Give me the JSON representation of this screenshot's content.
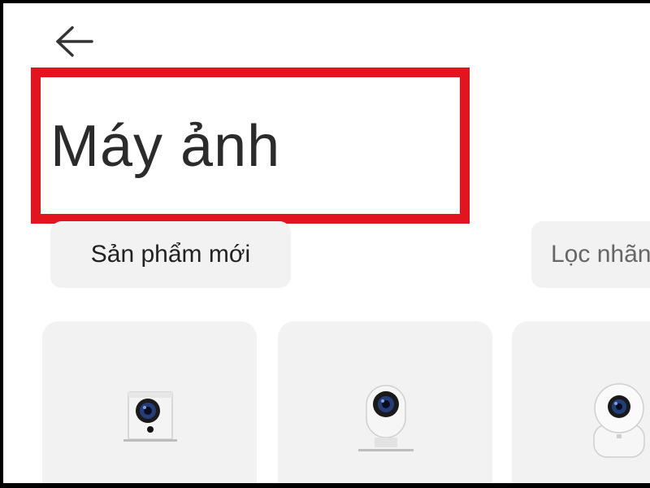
{
  "header": {
    "back_icon": "arrow-left-icon",
    "title": "Máy ảnh",
    "highlight_color": "#e3141e"
  },
  "filters": {
    "new_products_label": "Sản phẩm mới",
    "filter_label": "Lọc nhãn..."
  },
  "products": [
    {
      "icon": "square-camera-icon",
      "name": ""
    },
    {
      "icon": "stand-camera-icon",
      "name": ""
    },
    {
      "icon": "dome-camera-icon",
      "name": ""
    }
  ]
}
